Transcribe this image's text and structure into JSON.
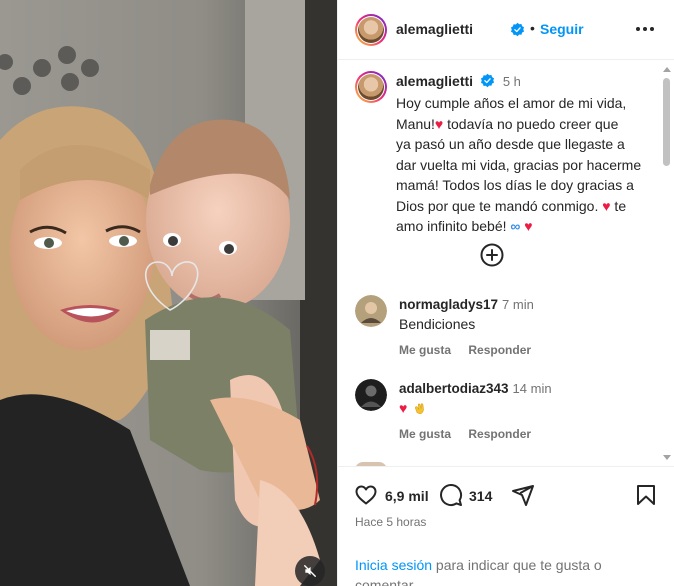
{
  "post": {
    "username": "alemaglietti",
    "follow_label": "Seguir",
    "dot": "•"
  },
  "caption": {
    "username": "alemaglietti",
    "time": "5 h",
    "line1": "Hoy cumple años el amor de mi vida,",
    "line2a": "Manu!",
    "line2b": " todavía no puedo creer que",
    "line3": "ya pasó un año desde que llegaste a",
    "line4": "dar vuelta mi vida, gracias por hacerme",
    "line5": "mamá! Todos los días le doy gracias a",
    "line6a": "Dios por que te mandó conmigo.",
    "line6b": " te",
    "line7": "amo infinito bebé!",
    "heart": "♥",
    "infinity": "∞"
  },
  "comments": [
    {
      "username": "normagladys17",
      "time": "7 min",
      "text": "Bendiciones",
      "like_label": "Me gusta",
      "reply_label": "Responder"
    },
    {
      "username": "adalbertodiaz343",
      "time": "14 min",
      "text": "♥",
      "like_label": "Me gusta",
      "reply_label": "Responder"
    }
  ],
  "footer": {
    "likes": "6,9 mil",
    "comments": "314",
    "posted": "Hace 5 horas",
    "login_link": "Inicia sesión",
    "login_rest": " para indicar que te gusta o comentar."
  },
  "icons": {
    "verified": "verified-badge-icon",
    "more": "more-options-icon",
    "like": "heart-icon",
    "comment": "comment-icon",
    "share": "share-icon",
    "save": "bookmark-icon",
    "mute": "muted-speaker-icon",
    "load_more": "plus-circle-icon"
  },
  "colors": {
    "link": "#0095f6",
    "heart": "#ed1c45",
    "muted_text": "#737373",
    "text": "#262626"
  }
}
